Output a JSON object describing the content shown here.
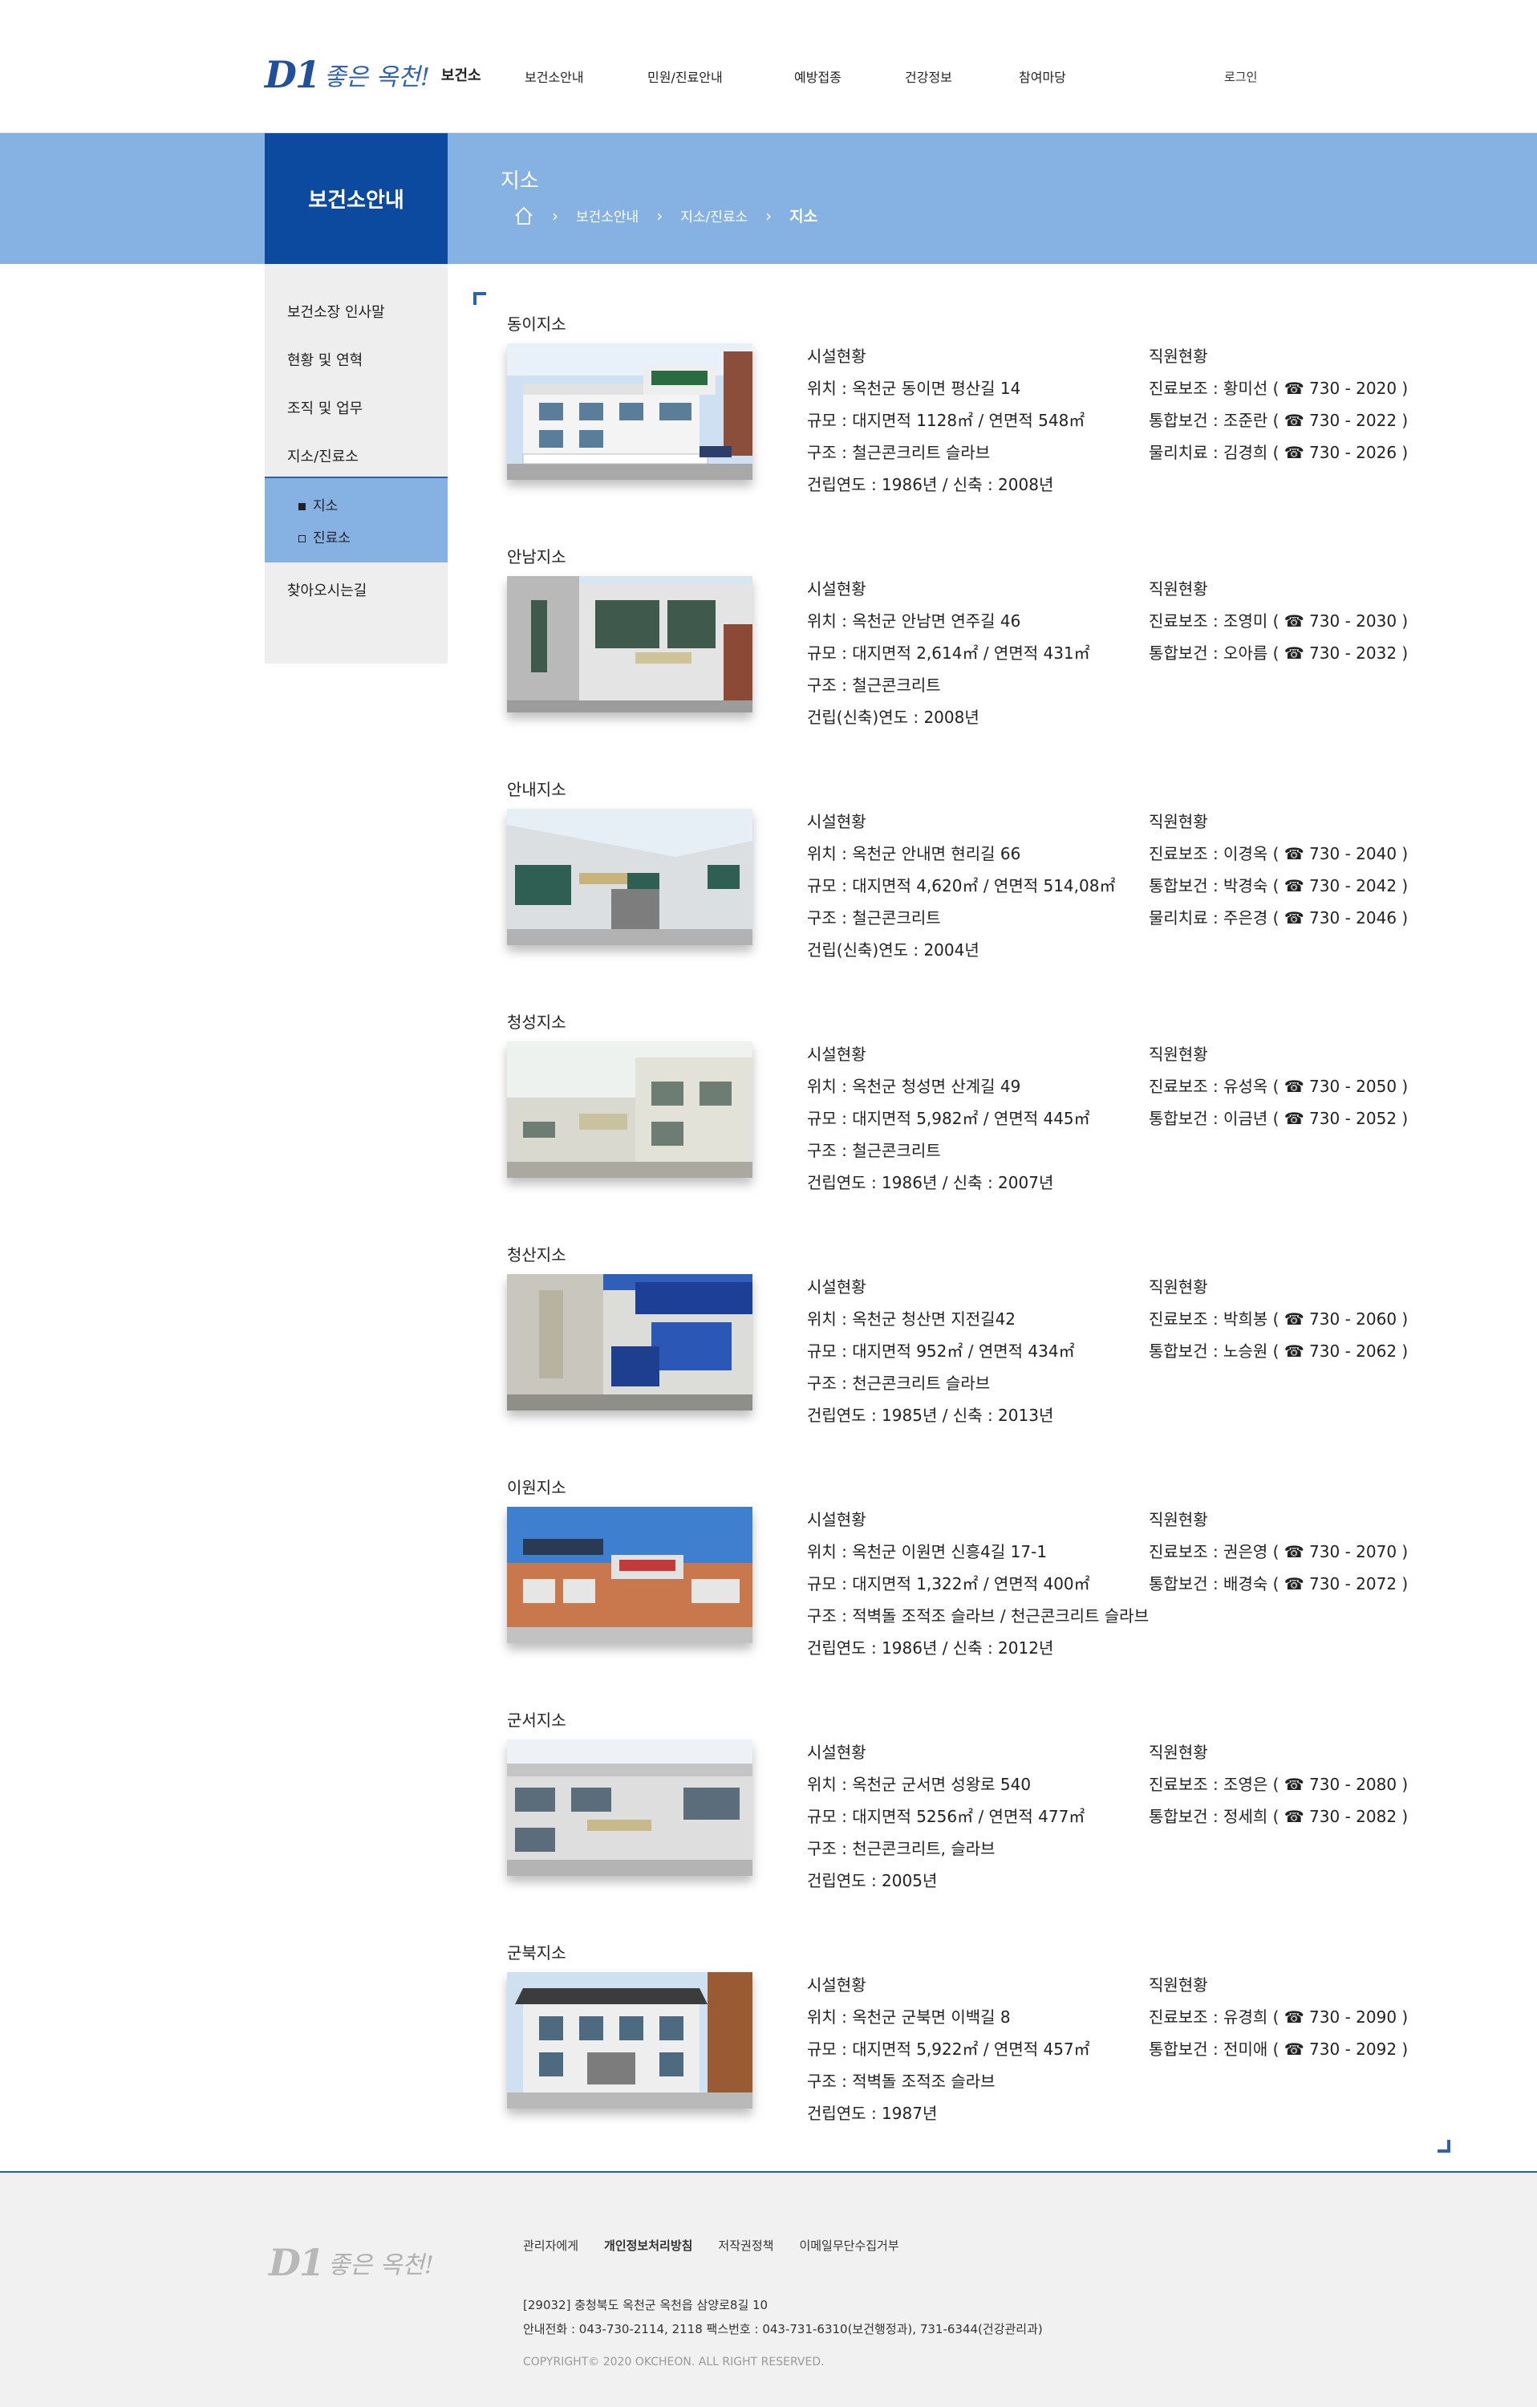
{
  "header": {
    "logo_mark": "D1",
    "logo_script": "좋은 옥천!",
    "logo_text": "보건소",
    "nav": [
      "보건소안내",
      "민원/진료안내",
      "예방접종",
      "건강정보",
      "참여마당"
    ],
    "login": "로그인"
  },
  "banner": {
    "section_title": "보건소안내",
    "page_title": "지소",
    "breadcrumb": [
      "보건소안내",
      "지소/진료소",
      "지소"
    ]
  },
  "sidebar": {
    "items": [
      "보건소장 인사말",
      "현황 및 연혁",
      "조직 및 업무",
      "지소/진료소",
      "찾아오시는길"
    ],
    "sub_items": [
      {
        "label": "지소",
        "active": true
      },
      {
        "label": "진료소",
        "active": false
      }
    ]
  },
  "branches": [
    {
      "name": "동이지소",
      "facility": [
        "시설현황",
        "위치 : 옥천군 동이면 평산길 14",
        "규모 : 대지면적 1128㎡ / 연면적 548㎡",
        "구조 : 철근콘크리트 슬라브",
        "건립연도 : 1986년 / 신축 : 2008년"
      ],
      "staff": [
        "직원현황",
        "진료보조 : 황미선 ( ☎ 730 - 2020 )",
        "통합보건 : 조준란 ( ☎ 730 - 2022 )",
        "물리치료 : 김경희 ( ☎ 730 - 2026 )"
      ]
    },
    {
      "name": "안남지소",
      "facility": [
        "시설현황",
        "위치 : 옥천군 안남면 연주길 46",
        "규모 : 대지면적 2,614㎡ / 연면적 431㎡",
        "구조 : 철근콘크리트",
        "건립(신축)연도 : 2008년"
      ],
      "staff": [
        "직원현황",
        "진료보조 : 조영미 ( ☎ 730 - 2030 )",
        "통합보건 : 오아름 ( ☎ 730 - 2032 )"
      ]
    },
    {
      "name": "안내지소",
      "facility": [
        "시설현황",
        "위치 : 옥천군 안내면 현리길 66",
        "규모 : 대지면적 4,620㎡ / 연면적 514,08㎡",
        "구조 : 철근콘크리트",
        "건립(신축)연도 : 2004년"
      ],
      "staff": [
        "직원현황",
        "진료보조 : 이경옥 ( ☎ 730 - 2040 )",
        "통합보건 : 박경숙 ( ☎ 730 - 2042 )",
        "물리치료 : 주은경 ( ☎ 730 - 2046 )"
      ]
    },
    {
      "name": "청성지소",
      "facility": [
        "시설현황",
        "위치 : 옥천군 청성면 산계길 49",
        "규모 : 대지면적 5,982㎡ / 연면적 445㎡",
        "구조 : 철근콘크리트",
        "건립연도 : 1986년 / 신축 : 2007년"
      ],
      "staff": [
        "직원현황",
        "진료보조 : 유성옥 ( ☎ 730 - 2050 )",
        "통합보건 : 이금년 ( ☎ 730 - 2052 )"
      ]
    },
    {
      "name": "청산지소",
      "facility": [
        "시설현황",
        "위치 : 옥천군 청산면 지전길42",
        "규모 : 대지면적 952㎡ / 연면적 434㎡",
        "구조 : 천근콘크리트 슬라브",
        "건립연도 : 1985년 / 신축 : 2013년"
      ],
      "staff": [
        "직원현황",
        "진료보조 : 박희봉 ( ☎ 730 - 2060 )",
        "통합보건 : 노승원 ( ☎ 730 - 2062 )"
      ]
    },
    {
      "name": "이원지소",
      "facility": [
        "시설현황",
        "위치 : 옥천군 이원면 신흥4길 17-1",
        "규모 : 대지면적 1,322㎡ / 연면적 400㎡",
        "구조 : 적벽돌 조적조 슬라브 / 천근콘크리트 슬라브",
        "건립연도 : 1986년 / 신축 : 2012년"
      ],
      "staff": [
        "직원현황",
        "진료보조 : 권은영 ( ☎ 730 - 2070 )",
        "통합보건 : 배경숙 ( ☎ 730 - 2072 )"
      ]
    },
    {
      "name": "군서지소",
      "facility": [
        "시설현황",
        "위치 : 옥천군 군서면 성왕로 540",
        "규모 : 대지면적 5256㎡ / 연면적 477㎡",
        "구조 : 천근콘크리트, 슬라브",
        "건립연도 : 2005년"
      ],
      "staff": [
        "직원현황",
        "진료보조 : 조영은 ( ☎ 730 - 2080 )",
        "통합보건 : 정세희 ( ☎ 730 - 2082 )"
      ]
    },
    {
      "name": "군북지소",
      "facility": [
        "시설현황",
        "위치 : 옥천군 군북면 이백길 8",
        "규모 : 대지면적 5,922㎡ / 연면적 457㎡",
        "구조 : 적벽돌 조적조 슬라브",
        "건립연도 : 1987년"
      ],
      "staff": [
        "직원현황",
        "진료보조 : 유경희 ( ☎ 730 - 2090 )",
        "통합보건 : 전미애 ( ☎ 730 - 2092 )"
      ]
    }
  ],
  "footer": {
    "logo_mark": "D1",
    "logo_script": "좋은 옥천!",
    "links": [
      "관리자에게",
      "개인정보처리방침",
      "저작권정책",
      "이메일무단수집거부"
    ],
    "address": "[29032] 충청북도 옥천군 옥천읍 삼양로8길 10",
    "phone": "안내전화 : 043-730-2114, 2118 팩스번호 : 043-731-6310(보건행정과), 731-6344(건강관리과)",
    "copyright": "COPYRIGHT© 2020 OKCHEON. ALL RIGHT RESERVED."
  },
  "colors": {
    "primary": "#0b4a9f",
    "banner": "#85b1e3",
    "accent_line": "#2c62b2"
  }
}
